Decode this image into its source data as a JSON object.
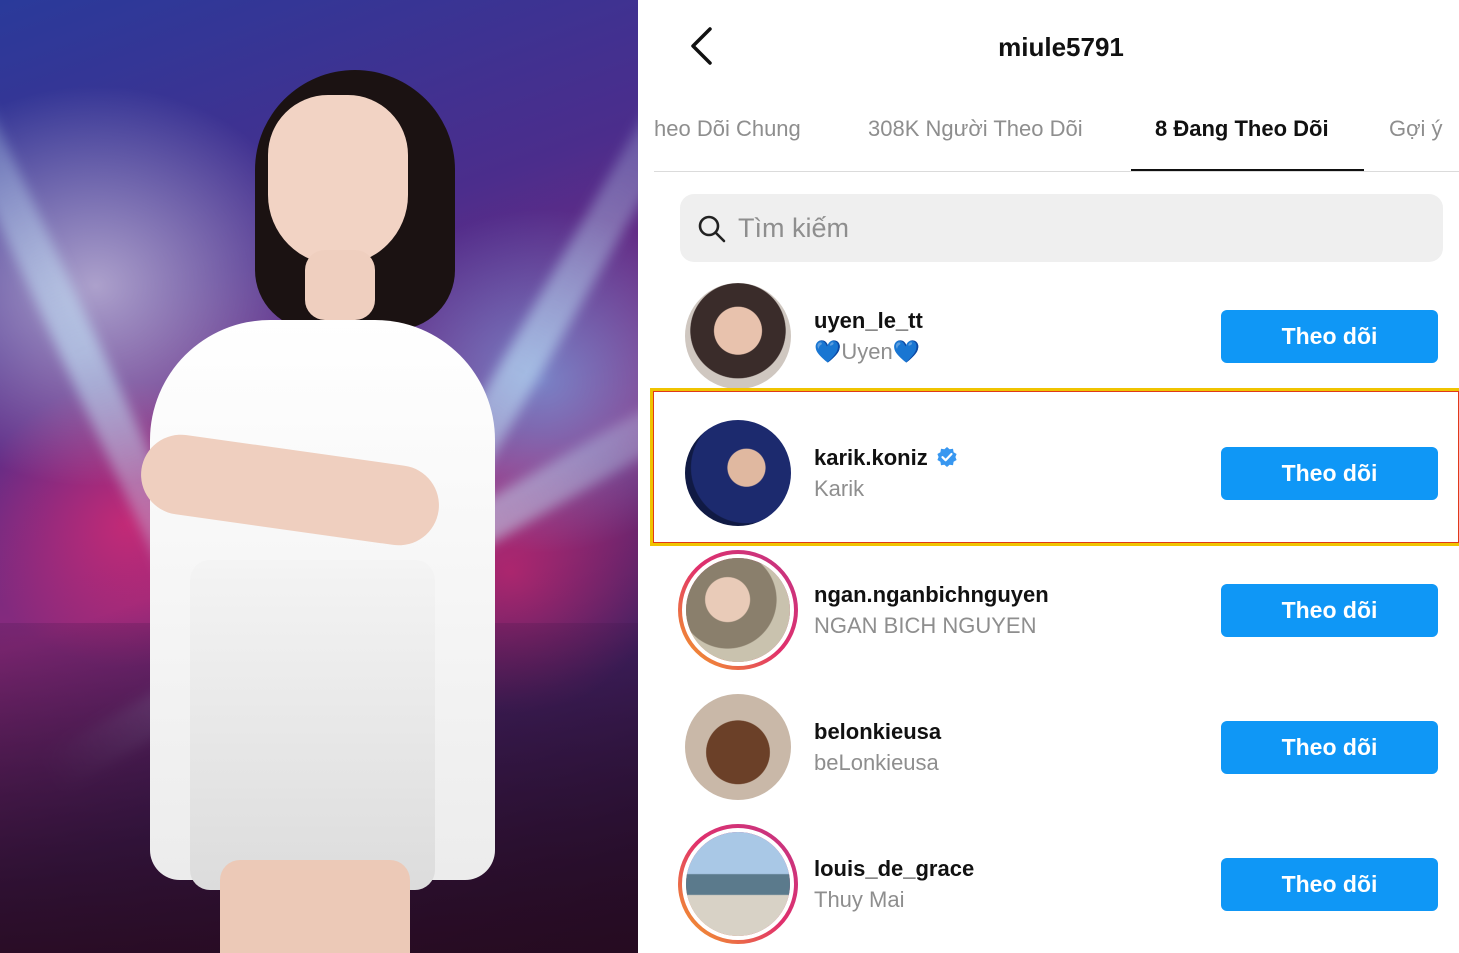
{
  "header": {
    "title": "miule5791"
  },
  "tabs": [
    {
      "label": "heo Dõi Chung",
      "active": false
    },
    {
      "label": "308K Người Theo Dõi",
      "active": false
    },
    {
      "label": "8 Đang Theo Dõi",
      "active": true
    },
    {
      "label": "Gợi ý",
      "active": false
    }
  ],
  "search": {
    "placeholder": "Tìm kiếm"
  },
  "accounts": [
    {
      "username": "uyen_le_tt",
      "fullname": "Uyen",
      "verified": false,
      "button": "Theo dõi"
    },
    {
      "username": "karik.koniz",
      "fullname": "Karik",
      "verified": true,
      "button": "Theo dõi"
    },
    {
      "username": "ngan.nganbichnguyen",
      "fullname": "NGAN BICH NGUYEN",
      "verified": false,
      "button": "Theo dõi"
    },
    {
      "username": "belonkieusa",
      "fullname": "beLonkieusa",
      "verified": false,
      "button": "Theo dõi"
    },
    {
      "username": "louis_de_grace",
      "fullname": "Thuy Mai",
      "verified": false,
      "button": "Theo dõi"
    }
  ],
  "colors": {
    "follow_button": "#0f97f6",
    "verified_badge": "#3897f0",
    "highlight_border": "#f0c400"
  },
  "icons": {
    "back": "chevron-left-icon",
    "search": "search-icon",
    "verified": "verified-badge-icon",
    "heart": "blue-heart-emoji"
  }
}
